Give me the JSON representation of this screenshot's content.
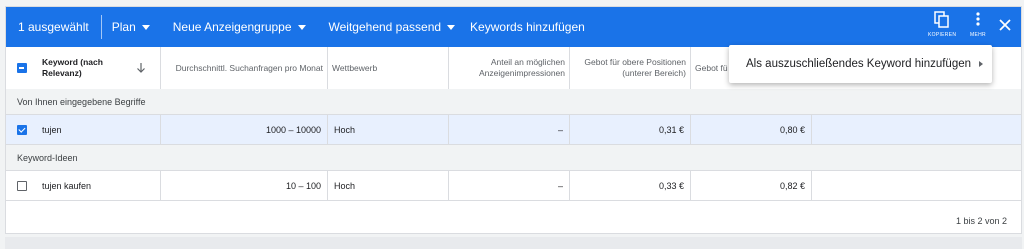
{
  "toolbar": {
    "selected_count": "1 ausgewählt",
    "plan": "Plan",
    "ad_group": "Neue Anzeigengruppe",
    "match_type": "Weitgehend passend",
    "add_keywords": "Keywords hinzufügen",
    "copy_label": "KOPIEREN",
    "more_label": "MEHR"
  },
  "columns": {
    "keyword": "Keyword (nach Relevanz)",
    "searches": "Durchschnittl. Suchanfragen pro Monat",
    "competition": "Wettbewerb",
    "impression_share": "Anteil an möglichen Anzeigenimpressionen",
    "bid_low": "Gebot für obere Positionen (unterer Bereich)",
    "bid_high": "Gebot fü"
  },
  "sections": {
    "entered": "Von Ihnen eingegebene Begriffe",
    "ideas": "Keyword-Ideen"
  },
  "rows": [
    {
      "keyword": "tujen",
      "searches": "1000 – 10000",
      "competition": "Hoch",
      "impression_share": "–",
      "bid_low": "0,31 €",
      "bid_high": "0,80 €",
      "selected": true
    },
    {
      "keyword": "tujen kaufen",
      "searches": "10 – 100",
      "competition": "Hoch",
      "impression_share": "–",
      "bid_low": "0,33 €",
      "bid_high": "0,82 €",
      "selected": false
    }
  ],
  "pagination": "1 bis 2 von 2",
  "menu": {
    "item": "Als auszuschließendes Keyword hinzufügen"
  },
  "colors": {
    "accent": "#1a73e8",
    "selected_row": "#e8f0fe"
  }
}
